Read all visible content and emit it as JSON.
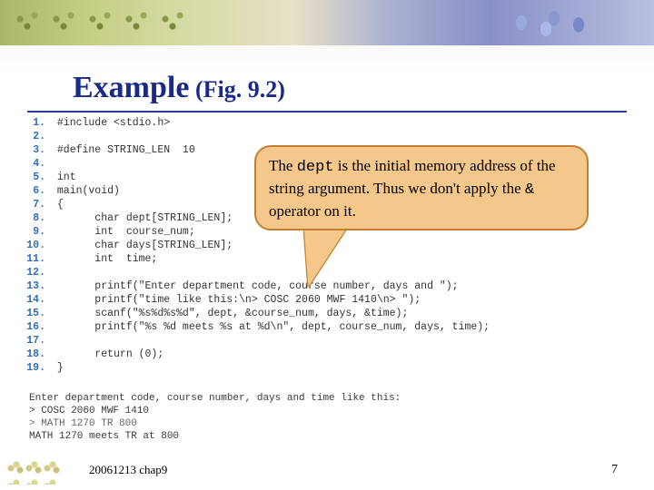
{
  "title_main": "Example",
  "title_sub": " (Fig. 9.2)",
  "callout": {
    "pre": "The ",
    "dept": "dept",
    "mid": " is the initial memory address of the string argument. Thus we don't apply the ",
    "amp": "&",
    "post": " operator on it."
  },
  "code": [
    "#include <stdio.h>",
    "",
    "#define STRING_LEN  10",
    "",
    "int",
    "main(void)",
    "{",
    "      char dept[STRING_LEN];",
    "      int  course_num;",
    "      char days[STRING_LEN];",
    "      int  time;",
    "",
    "      printf(\"Enter department code, course number, days and \");",
    "      printf(\"time like this:\\n> COSC 2060 MWF 1410\\n> \");",
    "      scanf(\"%s%d%s%d\", dept, &course_num, days, &time);",
    "      printf(\"%s %d meets %s at %d\\n\", dept, course_num, days, time);",
    "",
    "      return (0);",
    "}"
  ],
  "output": [
    "Enter department code, course number, days and time like this:",
    "> COSC 2060 MWF 1410",
    "> MATH 1270 TR 800",
    "MATH 1270 meets TR at 800"
  ],
  "footer_date": "20061213   chap9",
  "footer_page": "7"
}
